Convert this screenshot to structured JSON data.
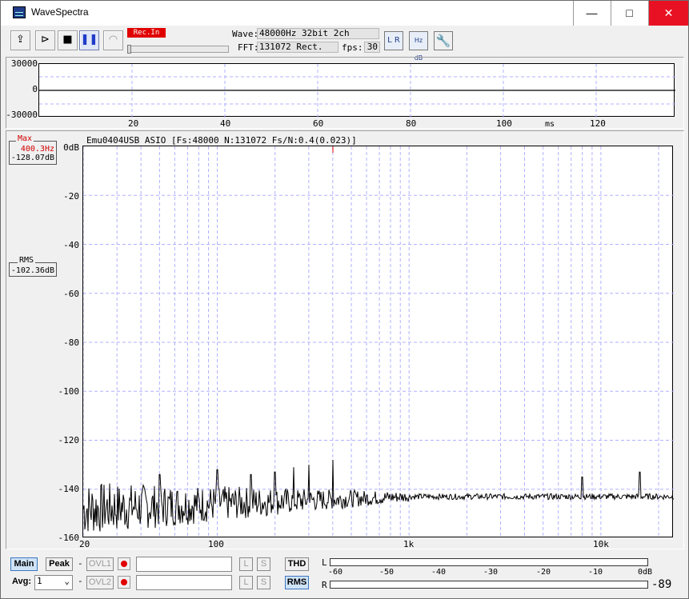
{
  "window": {
    "title": "WaveSpectra",
    "min_label": "—",
    "max_label": "□",
    "close_label": "✕"
  },
  "toolbar": {
    "rec_label": "Rec.In",
    "wave_label": "Wave:",
    "wave_value": "48000Hz 32bit 2ch",
    "fft_label": "FFT:",
    "fft_value": "131072 Rect.",
    "fps_label": "fps:",
    "fps_value": "30",
    "buttons": [
      "open-icon",
      "record-icon",
      "stop-icon",
      "pause-icon",
      "refresh-icon"
    ],
    "icon_lr": "L R",
    "icon_hzdb": "Hz dB"
  },
  "wave_view": {
    "y_labels": [
      "30000",
      "0",
      "-30000"
    ],
    "x_ticks": [
      "20",
      "40",
      "60",
      "80",
      "100",
      "120"
    ],
    "x_unit": "ms"
  },
  "spectrum": {
    "header": "Emu0404USB ASIO  [Fs:48000 N:131072 Fs/N:0.4(0.023)]",
    "y_labels": [
      "0dB",
      "-20",
      "-40",
      "-60",
      "-80",
      "-100",
      "-120",
      "-140",
      "-160"
    ],
    "x_labels": [
      "20",
      "100",
      "1k",
      "10k"
    ]
  },
  "max_box": {
    "caption": "Max",
    "freq": "400.3Hz",
    "level": "-128.07dB"
  },
  "rms_box": {
    "caption": "RMS",
    "level": "-102.36dB"
  },
  "bottom": {
    "main": "Main",
    "peak": "Peak",
    "dash": "-",
    "ovl1": "OVL1",
    "ovl2": "OVL2",
    "avg_label": "Avg:",
    "avg_value": "1",
    "l": "L",
    "s": "S",
    "thd": "THD",
    "rms": "RMS"
  },
  "level_meter": {
    "l": "L",
    "r": "R",
    "scale": [
      "-60",
      "-50",
      "-40",
      "-30",
      "-20",
      "-10",
      "0dB"
    ],
    "readout": "-89"
  },
  "colors": {
    "accent_red": "#e00000",
    "max_text": "#d00000",
    "grid": "#b0b0ff"
  }
}
